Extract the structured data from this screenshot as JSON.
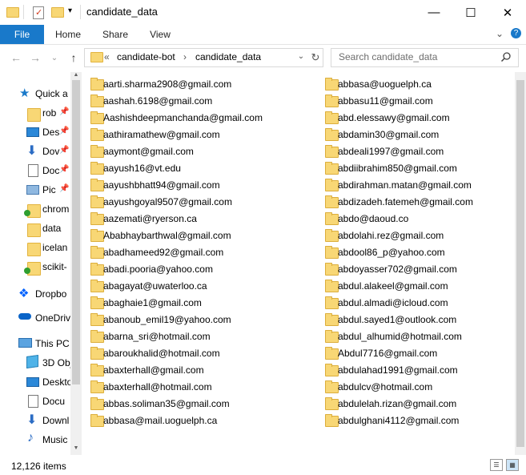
{
  "window": {
    "title": "candidate_data",
    "controls": {
      "minimize": "—",
      "maximize": "☐",
      "close": "✕"
    }
  },
  "ribbon": {
    "tabs": [
      "File",
      "Home",
      "Share",
      "View"
    ],
    "expand": "⌄",
    "help": "?"
  },
  "address": {
    "prefix": "«",
    "crumbs": [
      "candidate-bot",
      "candidate_data"
    ],
    "separator": "›",
    "dropdown": "⌄",
    "refresh": "↻"
  },
  "search": {
    "placeholder": "Search candidate_data"
  },
  "nav": {
    "back": "←",
    "forward": "→",
    "recent": "⌄",
    "up": "↑",
    "items": [
      {
        "label": "Quick a",
        "icon": "star-icon"
      },
      {
        "label": "rob",
        "icon": "folder-icon"
      },
      {
        "label": "Des",
        "icon": "desktop-icon"
      },
      {
        "label": "Dov",
        "icon": "download-icon"
      },
      {
        "label": "Doc",
        "icon": "document-icon"
      },
      {
        "label": "Pic",
        "icon": "picture-icon"
      },
      {
        "label": "chrom",
        "icon": "folder-icon"
      },
      {
        "label": "data",
        "icon": "folder-icon"
      },
      {
        "label": "icelan",
        "icon": "folder-icon"
      },
      {
        "label": "scikit-",
        "icon": "folder-icon"
      },
      {
        "label": "Dropbo",
        "icon": "dropbox-icon"
      },
      {
        "label": "OneDriv",
        "icon": "onedrive-icon"
      },
      {
        "label": "This PC",
        "icon": "computer-icon"
      },
      {
        "label": "3D Obj",
        "icon": "cube-icon"
      },
      {
        "label": "Deskto",
        "icon": "desktop-icon"
      },
      {
        "label": "Docu",
        "icon": "document-icon"
      },
      {
        "label": "Downl",
        "icon": "download-icon"
      },
      {
        "label": "Music",
        "icon": "music-icon"
      }
    ]
  },
  "files": {
    "col1": [
      "aarti.sharma2908@gmail.com",
      "aashah.6198@gmail.com",
      "Aashishdeepmanchanda@gmail.com",
      "aathiramathew@gmail.com",
      "aaymont@gmail.com",
      "aayush16@vt.edu",
      "aayushbhatt94@gmail.com",
      "aayushgoyal9507@gmail.com",
      "aazemati@ryerson.ca",
      "Ababhaybarthwal@gmail.com",
      "abadhameed92@gmail.com",
      "abadi.pooria@yahoo.com",
      "abagayat@uwaterloo.ca",
      "abaghaie1@gmail.com",
      "abanoub_emil19@yahoo.com",
      "abarna_sri@hotmail.com",
      "abaroukhalid@hotmail.com",
      "abaxterhall@gmail.com",
      "abaxterhall@hotmail.com",
      "abbas.soliman35@gmail.com",
      "abbasa@mail.uoguelph.ca"
    ],
    "col2": [
      "abbasa@uoguelph.ca",
      "abbasu11@gmail.com",
      "abd.elessawy@gmail.com",
      "abdamin30@gmail.com",
      "abdeali1997@gmail.com",
      "abdiibrahim850@gmail.com",
      "abdirahman.matan@gmail.com",
      "abdizadeh.fatemeh@gmail.com",
      "abdo@daoud.co",
      "abdolahi.rez@gmail.com",
      "abdool86_p@yahoo.com",
      "abdoyasser702@gmail.com",
      "abdul.alakeel@gmail.com",
      "abdul.almadi@icloud.com",
      "abdul.sayed1@outlook.com",
      "abdul_alhumid@hotmail.com",
      "Abdul7716@gmail.com",
      "abdulahad1991@gmail.com",
      "abdulcv@hotmail.com",
      "abdulelah.rizan@gmail.com",
      "abdulghani4112@gmail.com"
    ]
  },
  "status": {
    "count": "12,126 items"
  },
  "colors": {
    "accent": "#1979ca",
    "folder": "#f8d775"
  }
}
